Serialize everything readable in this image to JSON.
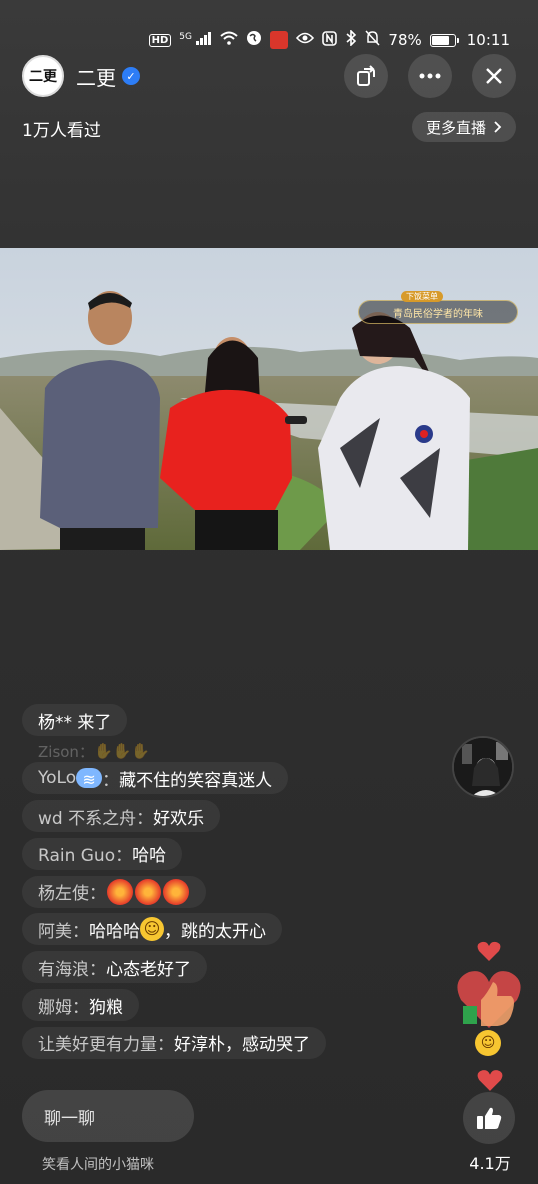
{
  "status_bar": {
    "hd": "HD",
    "signal": "5G",
    "battery_text": "78%",
    "battery_level": 0.78,
    "time": "10:11"
  },
  "header": {
    "avatar_text": "二更",
    "channel_name": "二更",
    "viewers": "1万人看过",
    "more_live": "更多直播"
  },
  "video": {
    "banner_badge": "下饭菜单",
    "banner_text": "青岛民俗学者的年味"
  },
  "comments": [
    {
      "user": "杨** 来了",
      "text": ""
    },
    {
      "user": "Zison：",
      "text": "",
      "faded": true
    },
    {
      "user": "YoLo",
      "text": "藏不住的笑容真迷人",
      "emoji": "puff"
    },
    {
      "user": "wd 不系之舟：",
      "text": "好欢乐"
    },
    {
      "user": "Rain Guo：",
      "text": "哈哈"
    },
    {
      "user": "杨左使：",
      "text": "",
      "emoji": "fire3"
    },
    {
      "user": "阿美：",
      "text": "哈哈哈",
      "emoji": "smile",
      "text_after": "，跳的太开心"
    },
    {
      "user": "有海浪：",
      "text": "心态老好了"
    },
    {
      "user": "娜姆：",
      "text": "狗粮"
    },
    {
      "user": "让美好更有力量：",
      "text": "好淳朴，感动哭了"
    }
  ],
  "footer": {
    "chat_placeholder": "聊一聊",
    "tip": "笑看人间的小猫咪",
    "like_count": "4.1万"
  },
  "colors": {
    "accent_blue": "#2d7df6",
    "heart_red": "#e04a4a"
  },
  "icons": [
    "share-icon",
    "more-icon",
    "close-icon",
    "chevron-right-icon",
    "verified-icon",
    "thumbs-up-icon",
    "heart-icon"
  ]
}
